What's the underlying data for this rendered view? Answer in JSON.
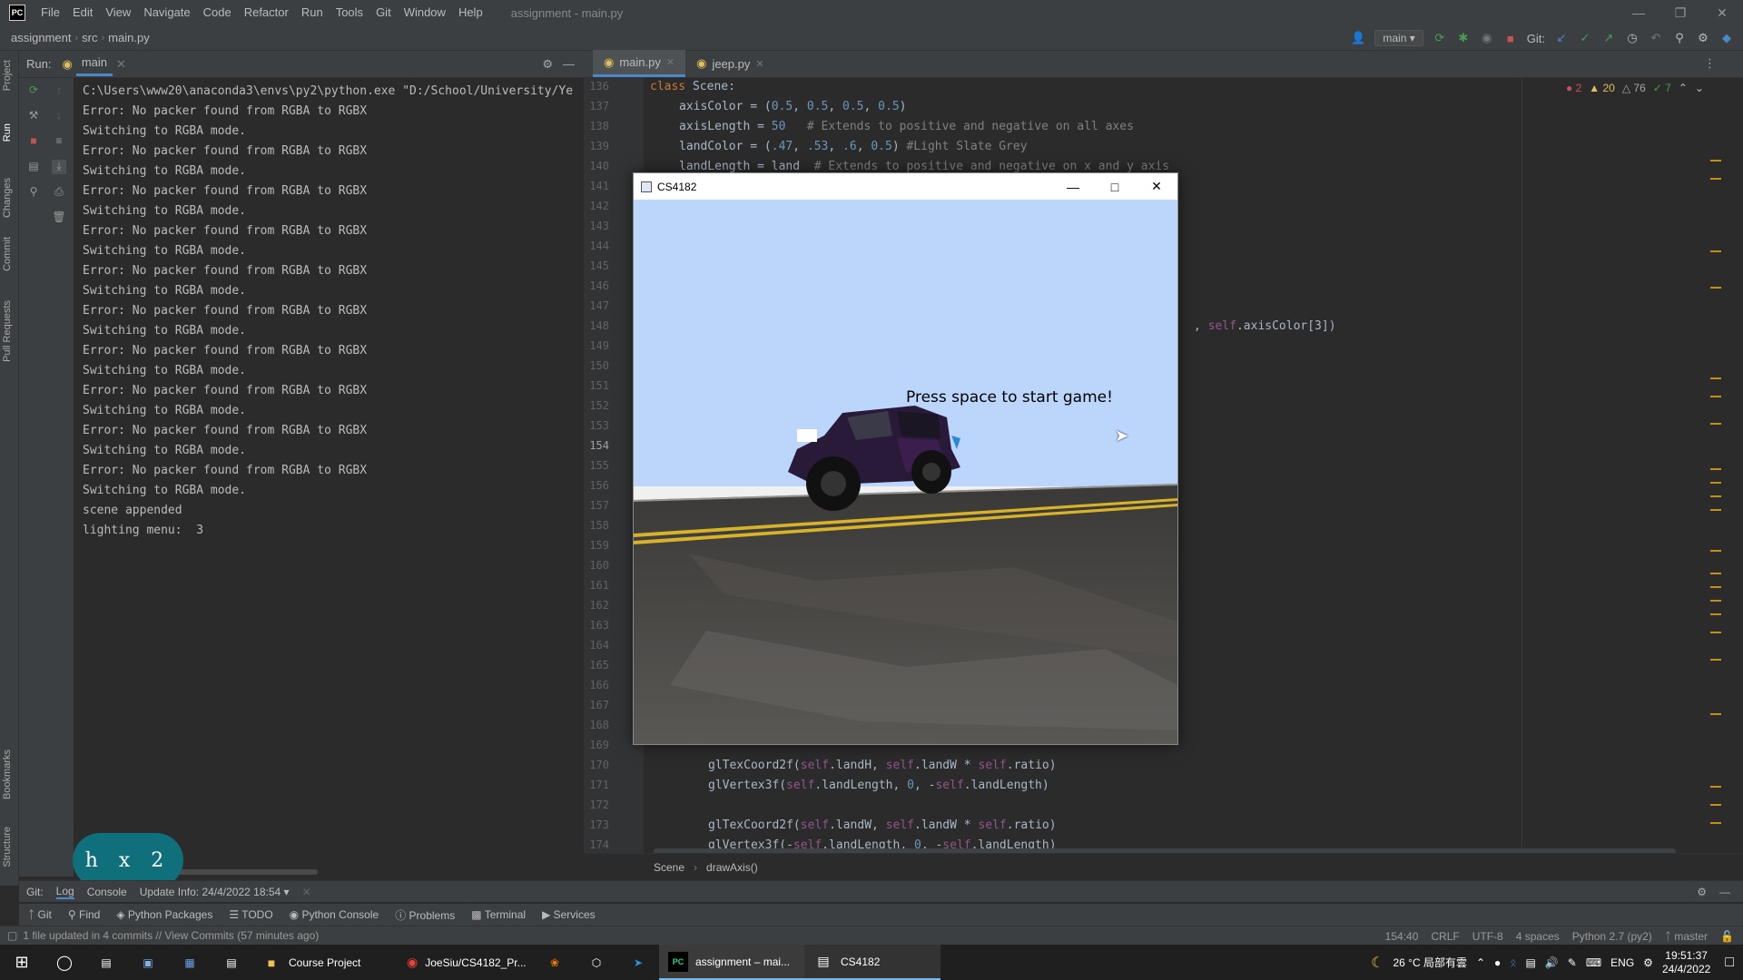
{
  "app": {
    "logo": "PC",
    "window_title": "assignment - main.py",
    "menu": [
      "File",
      "Edit",
      "View",
      "Navigate",
      "Code",
      "Refactor",
      "Run",
      "Tools",
      "Git",
      "Window",
      "Help"
    ]
  },
  "navbar": {
    "breadcrumbs": [
      "assignment",
      "src",
      "main.py"
    ],
    "run_config": "main",
    "git_label": "Git:"
  },
  "left_strip": {
    "labels": [
      "Project",
      "Run",
      "Changes",
      "Commit",
      "Pull Requests",
      "Bookmarks",
      "Structure"
    ]
  },
  "run_panel": {
    "label": "Run:",
    "tab": "main",
    "lines": [
      "C:\\Users\\www20\\anaconda3\\envs\\py2\\python.exe \"D:/School/University/Ye",
      "Error: No packer found from RGBA to RGBX",
      "Switching to RGBA mode.",
      "Error: No packer found from RGBA to RGBX",
      "Switching to RGBA mode.",
      "Error: No packer found from RGBA to RGBX",
      "Switching to RGBA mode.",
      "Error: No packer found from RGBA to RGBX",
      "Switching to RGBA mode.",
      "Error: No packer found from RGBA to RGBX",
      "Switching to RGBA mode.",
      "Error: No packer found from RGBA to RGBX",
      "Switching to RGBA mode.",
      "Error: No packer found from RGBA to RGBX",
      "Switching to RGBA mode.",
      "Error: No packer found from RGBA to RGBX",
      "Switching to RGBA mode.",
      "Error: No packer found from RGBA to RGBX",
      "Switching to RGBA mode.",
      "Error: No packer found from RGBA to RGBX",
      "Switching to RGBA mode.",
      "scene appended",
      "lighting menu:  3"
    ]
  },
  "editor": {
    "tabs": [
      {
        "label": "main.py",
        "active": true
      },
      {
        "label": "jeep.py",
        "active": false
      }
    ],
    "inspections": {
      "errors": "2",
      "warnings": "20",
      "weak_warnings": "76",
      "ok": "7"
    },
    "first_line": 136,
    "last_line": 174,
    "current_line": "154",
    "breadcrumb": [
      "Scene",
      "drawAxis()"
    ],
    "code_fragment_151": "self.axisColor[3])"
  },
  "game_window": {
    "title": "CS4182",
    "message": "Press space to start game!",
    "colors": {
      "sky": "#bcd6fb",
      "road": "#4a4845",
      "lane": "#d8b32a",
      "jeep": "#2a1a3a"
    }
  },
  "bottom_bar": {
    "git": "Git:",
    "log": "Log",
    "console": "Console",
    "update_info": "Update Info: 24/4/2022 18:54",
    "tool_tabs": [
      "Git",
      "Find",
      "Python Packages",
      "TODO",
      "Python Console",
      "Problems",
      "Terminal",
      "Services"
    ]
  },
  "status_bar": {
    "message": "1 file updated in 4 commits // View Commits (57 minutes ago)",
    "position": "154:40",
    "line_sep": "CRLF",
    "encoding": "UTF-8",
    "indent": "4 spaces",
    "interpreter": "Python 2.7 (py2)",
    "branch": "master"
  },
  "key_overlay": {
    "text": "h x 2"
  },
  "taskbar": {
    "items": [
      {
        "label": "Course Project",
        "icon": "folder-icon"
      },
      {
        "label": "JoeSiu/CS4182_Pr...",
        "icon": "chrome-icon"
      },
      {
        "label": "assignment – mai...",
        "icon": "pycharm-icon"
      },
      {
        "label": "CS4182",
        "icon": "window-icon"
      }
    ],
    "weather": "26 °C  局部有雲",
    "language": "ENG",
    "time": "19:51:37",
    "date": "24/4/2022"
  }
}
